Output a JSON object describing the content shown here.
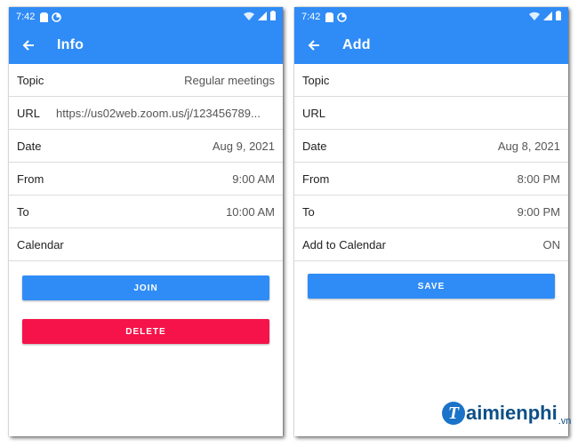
{
  "left_screen": {
    "status": {
      "time": "7:42"
    },
    "title": "Info",
    "rows": [
      {
        "label": "Topic",
        "value": "Regular meetings"
      },
      {
        "label": "URL",
        "value": "https://us02web.zoom.us/j/123456789..."
      },
      {
        "label": "Date",
        "value": "Aug 9, 2021"
      },
      {
        "label": "From",
        "value": "9:00 AM"
      },
      {
        "label": "To",
        "value": "10:00 AM"
      },
      {
        "label": "Calendar",
        "value": ""
      }
    ],
    "join_label": "JOIN",
    "delete_label": "DELETE"
  },
  "right_screen": {
    "status": {
      "time": "7:42"
    },
    "title": "Add",
    "rows": [
      {
        "label": "Topic",
        "value": ""
      },
      {
        "label": "URL",
        "value": ""
      },
      {
        "label": "Date",
        "value": "Aug 8, 2021"
      },
      {
        "label": "From",
        "value": "8:00 PM"
      },
      {
        "label": "To",
        "value": "9:00 PM"
      },
      {
        "label": "Add to Calendar",
        "value": "ON"
      }
    ],
    "save_label": "SAVE"
  },
  "watermark": {
    "brand": "aimienphi",
    "suffix": ".vn",
    "initial": "T"
  },
  "colors": {
    "primary": "#2f8cf6",
    "danger": "#f5134a",
    "divider": "#dcdcdc"
  },
  "icons": [
    "back-arrow-icon",
    "sim-card-icon",
    "data-saver-icon",
    "wifi-icon",
    "signal-icon",
    "battery-icon"
  ]
}
